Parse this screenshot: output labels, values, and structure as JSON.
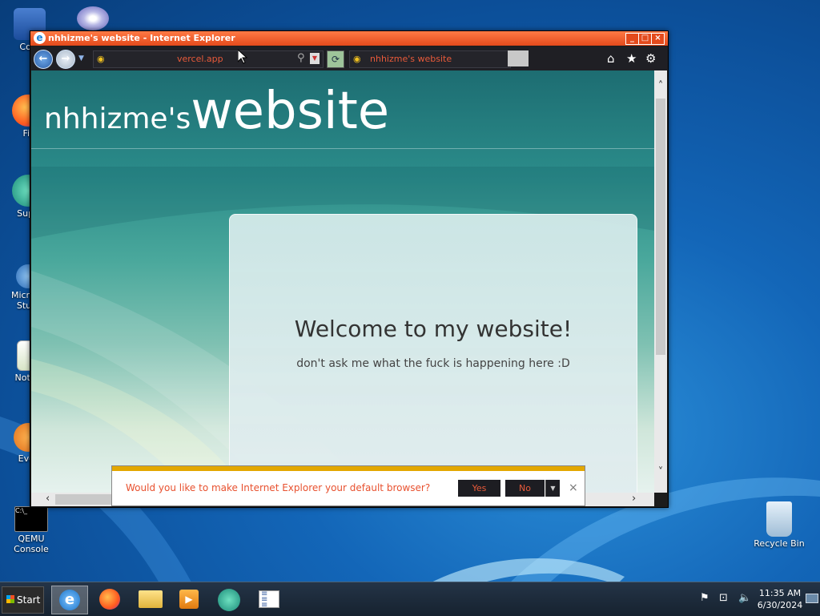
{
  "desktop": {
    "icons": [
      {
        "label": "Com",
        "glyph": "computer-icon"
      },
      {
        "label": "Fir",
        "glyph": "firefox-icon"
      },
      {
        "label": "Supe",
        "glyph": "app-icon"
      },
      {
        "label": "Microso Studi",
        "glyph": "visual-studio-icon"
      },
      {
        "label": "Notep",
        "glyph": "notepad-icon"
      },
      {
        "label": "Ever",
        "glyph": "everything-icon"
      },
      {
        "label": "QEMU Console",
        "glyph": "console-icon"
      },
      {
        "label": "Recycle Bin",
        "glyph": "recycle-bin-icon"
      }
    ]
  },
  "window": {
    "title": "nhhizme's website - Internet Explorer",
    "controls": {
      "minimize": "_",
      "maximize": "□",
      "close": "×"
    }
  },
  "toolbar": {
    "back": "←",
    "forward": "→",
    "address_url": "vercel.app",
    "tab_title": "nhhizme's website",
    "home": "⌂",
    "favorites": "★",
    "tools": "⚙"
  },
  "page": {
    "site_name_small": "nhhizme's",
    "site_name_big": "website",
    "heading": "Welcome to my website!",
    "subtext": "don't ask me what the fuck is happening here :D"
  },
  "notification": {
    "message": "Would you like to make Internet Explorer your default browser?",
    "yes": "Yes",
    "no": "No",
    "close": "×"
  },
  "taskbar": {
    "start_label": "Start",
    "apps": [
      "internet-explorer-icon",
      "firefox-icon",
      "file-explorer-icon",
      "media-player-icon",
      "app-icon",
      "task-list-icon"
    ],
    "clock_time": "11:35 AM",
    "clock_date": "6/30/2024"
  },
  "colors": {
    "ie_title": "#e44a1c",
    "accent_text": "#e85a3a",
    "notify_stripe": "#e3a700"
  }
}
